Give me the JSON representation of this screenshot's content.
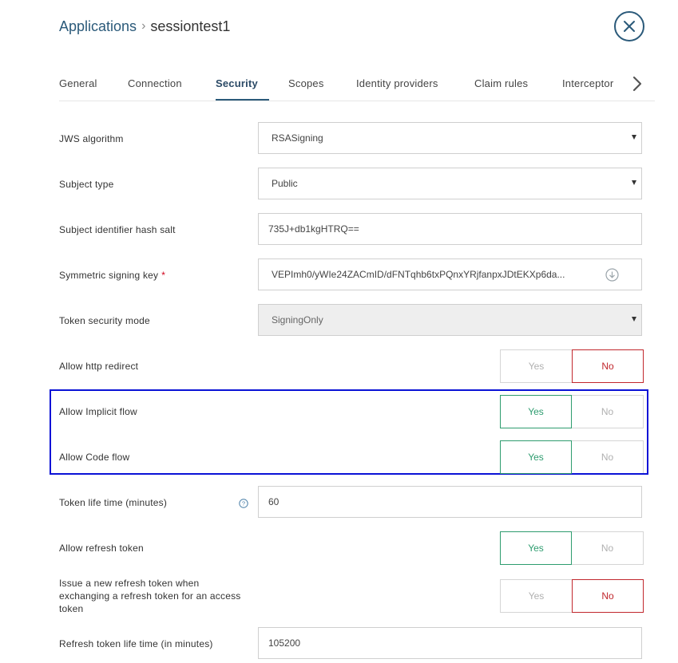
{
  "breadcrumb": {
    "parent": "Applications",
    "separator": "›",
    "current": "sessiontest1"
  },
  "tabs": [
    {
      "label": "General"
    },
    {
      "label": "Connection"
    },
    {
      "label": "Security",
      "active": true
    },
    {
      "label": "Scopes"
    },
    {
      "label": "Identity providers"
    },
    {
      "label": "Claim rules"
    },
    {
      "label": "Interceptor"
    }
  ],
  "form": {
    "jws_algorithm": {
      "label": "JWS algorithm",
      "value": "RSASigning"
    },
    "subject_type": {
      "label": "Subject type",
      "value": "Public"
    },
    "subject_hash_salt": {
      "label": "Subject identifier hash salt",
      "value": "735J+db1kgHTRQ=="
    },
    "symmetric_signing_key": {
      "label": "Symmetric signing key",
      "required_mark": "*",
      "value": "VEPImh0/yWIe24ZACmID/dFNTqhb6txPQnxYRjfanpxJDtEKXp6da..."
    },
    "token_security_mode": {
      "label": "Token security mode",
      "value": "SigningOnly"
    },
    "allow_http_redirect": {
      "label": "Allow http redirect",
      "yes": "Yes",
      "no": "No",
      "selected": "No"
    },
    "allow_implicit_flow": {
      "label": "Allow Implicit flow",
      "yes": "Yes",
      "no": "No",
      "selected": "Yes"
    },
    "allow_code_flow": {
      "label": "Allow Code flow",
      "yes": "Yes",
      "no": "No",
      "selected": "Yes"
    },
    "token_lifetime": {
      "label": "Token life time (minutes)",
      "value": "60"
    },
    "allow_refresh_token": {
      "label": "Allow refresh token",
      "yes": "Yes",
      "no": "No",
      "selected": "Yes"
    },
    "issue_new_refresh_token": {
      "label_line1": "Issue a new refresh token when",
      "label_line2": "exchanging a refresh token for an access",
      "label_line3": "token",
      "yes": "Yes",
      "no": "No",
      "selected": "No"
    },
    "refresh_token_lifetime": {
      "label": "Refresh token life time (in minutes)",
      "value": "105200"
    }
  },
  "colors": {
    "accent": "#2b5a7a",
    "yes_green": "#2e9c6f",
    "no_red": "#c1272d",
    "highlight": "#0a12d6"
  }
}
